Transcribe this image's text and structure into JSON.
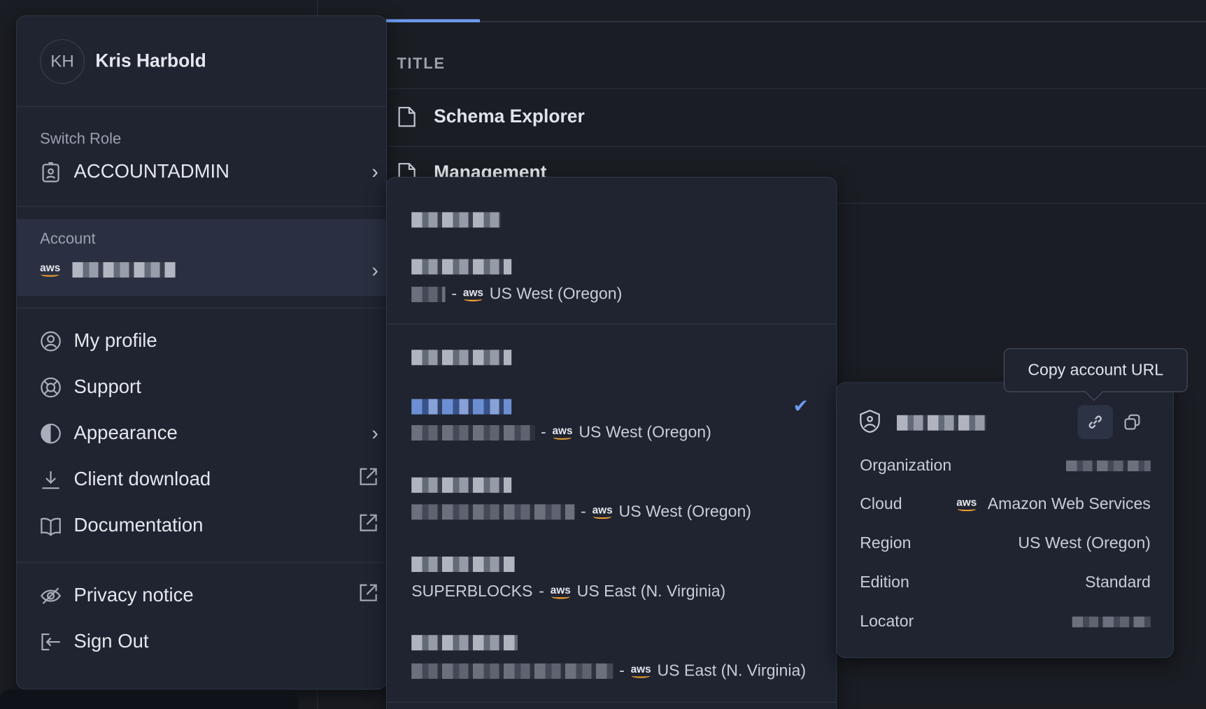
{
  "table": {
    "header": "TITLE",
    "rows": [
      {
        "title": "Schema Explorer",
        "icon": "file-icon"
      },
      {
        "title": "Management",
        "icon": "file-icon"
      }
    ]
  },
  "user_menu": {
    "initials": "KH",
    "name": "Kris Harbold",
    "switch_role": {
      "label": "Switch Role",
      "value": "ACCOUNTADMIN"
    },
    "account": {
      "label": "Account",
      "cloud": "aws"
    },
    "items": [
      {
        "label": "My profile",
        "icon": "user-circle-icon"
      },
      {
        "label": "Support",
        "icon": "lifebuoy-icon"
      },
      {
        "label": "Appearance",
        "icon": "contrast-icon",
        "trailing": "chevron"
      },
      {
        "label": "Client download",
        "icon": "download-icon",
        "trailing": "external"
      },
      {
        "label": "Documentation",
        "icon": "book-icon",
        "trailing": "external"
      },
      {
        "label": "Privacy notice",
        "icon": "eye-off-icon",
        "trailing": "external"
      },
      {
        "label": "Sign Out",
        "icon": "sign-out-icon"
      }
    ]
  },
  "account_list": {
    "accounts": [
      {
        "region": "US West (Oregon)",
        "cloud": "aws"
      },
      {
        "region": "US West (Oregon)",
        "cloud": "aws",
        "selected": true
      },
      {
        "region": "US West (Oregon)",
        "cloud": "aws"
      },
      {
        "org": "SUPERBLOCKS",
        "region": "US East (N. Virginia)",
        "cloud": "aws"
      },
      {
        "region": "US East (N. Virginia)",
        "cloud": "aws"
      }
    ]
  },
  "account_card": {
    "tooltip": "Copy account URL",
    "fields": [
      {
        "label": "Organization"
      },
      {
        "label": "Cloud",
        "value": "Amazon Web Services"
      },
      {
        "label": "Region",
        "value": "US West (Oregon)"
      },
      {
        "label": "Edition",
        "value": "Standard"
      },
      {
        "label": "Locator"
      }
    ]
  },
  "colors": {
    "accent": "#6d9bf0",
    "aws_smile": "#f0a030",
    "panel": "#1f2430",
    "background": "#1a1d23"
  }
}
